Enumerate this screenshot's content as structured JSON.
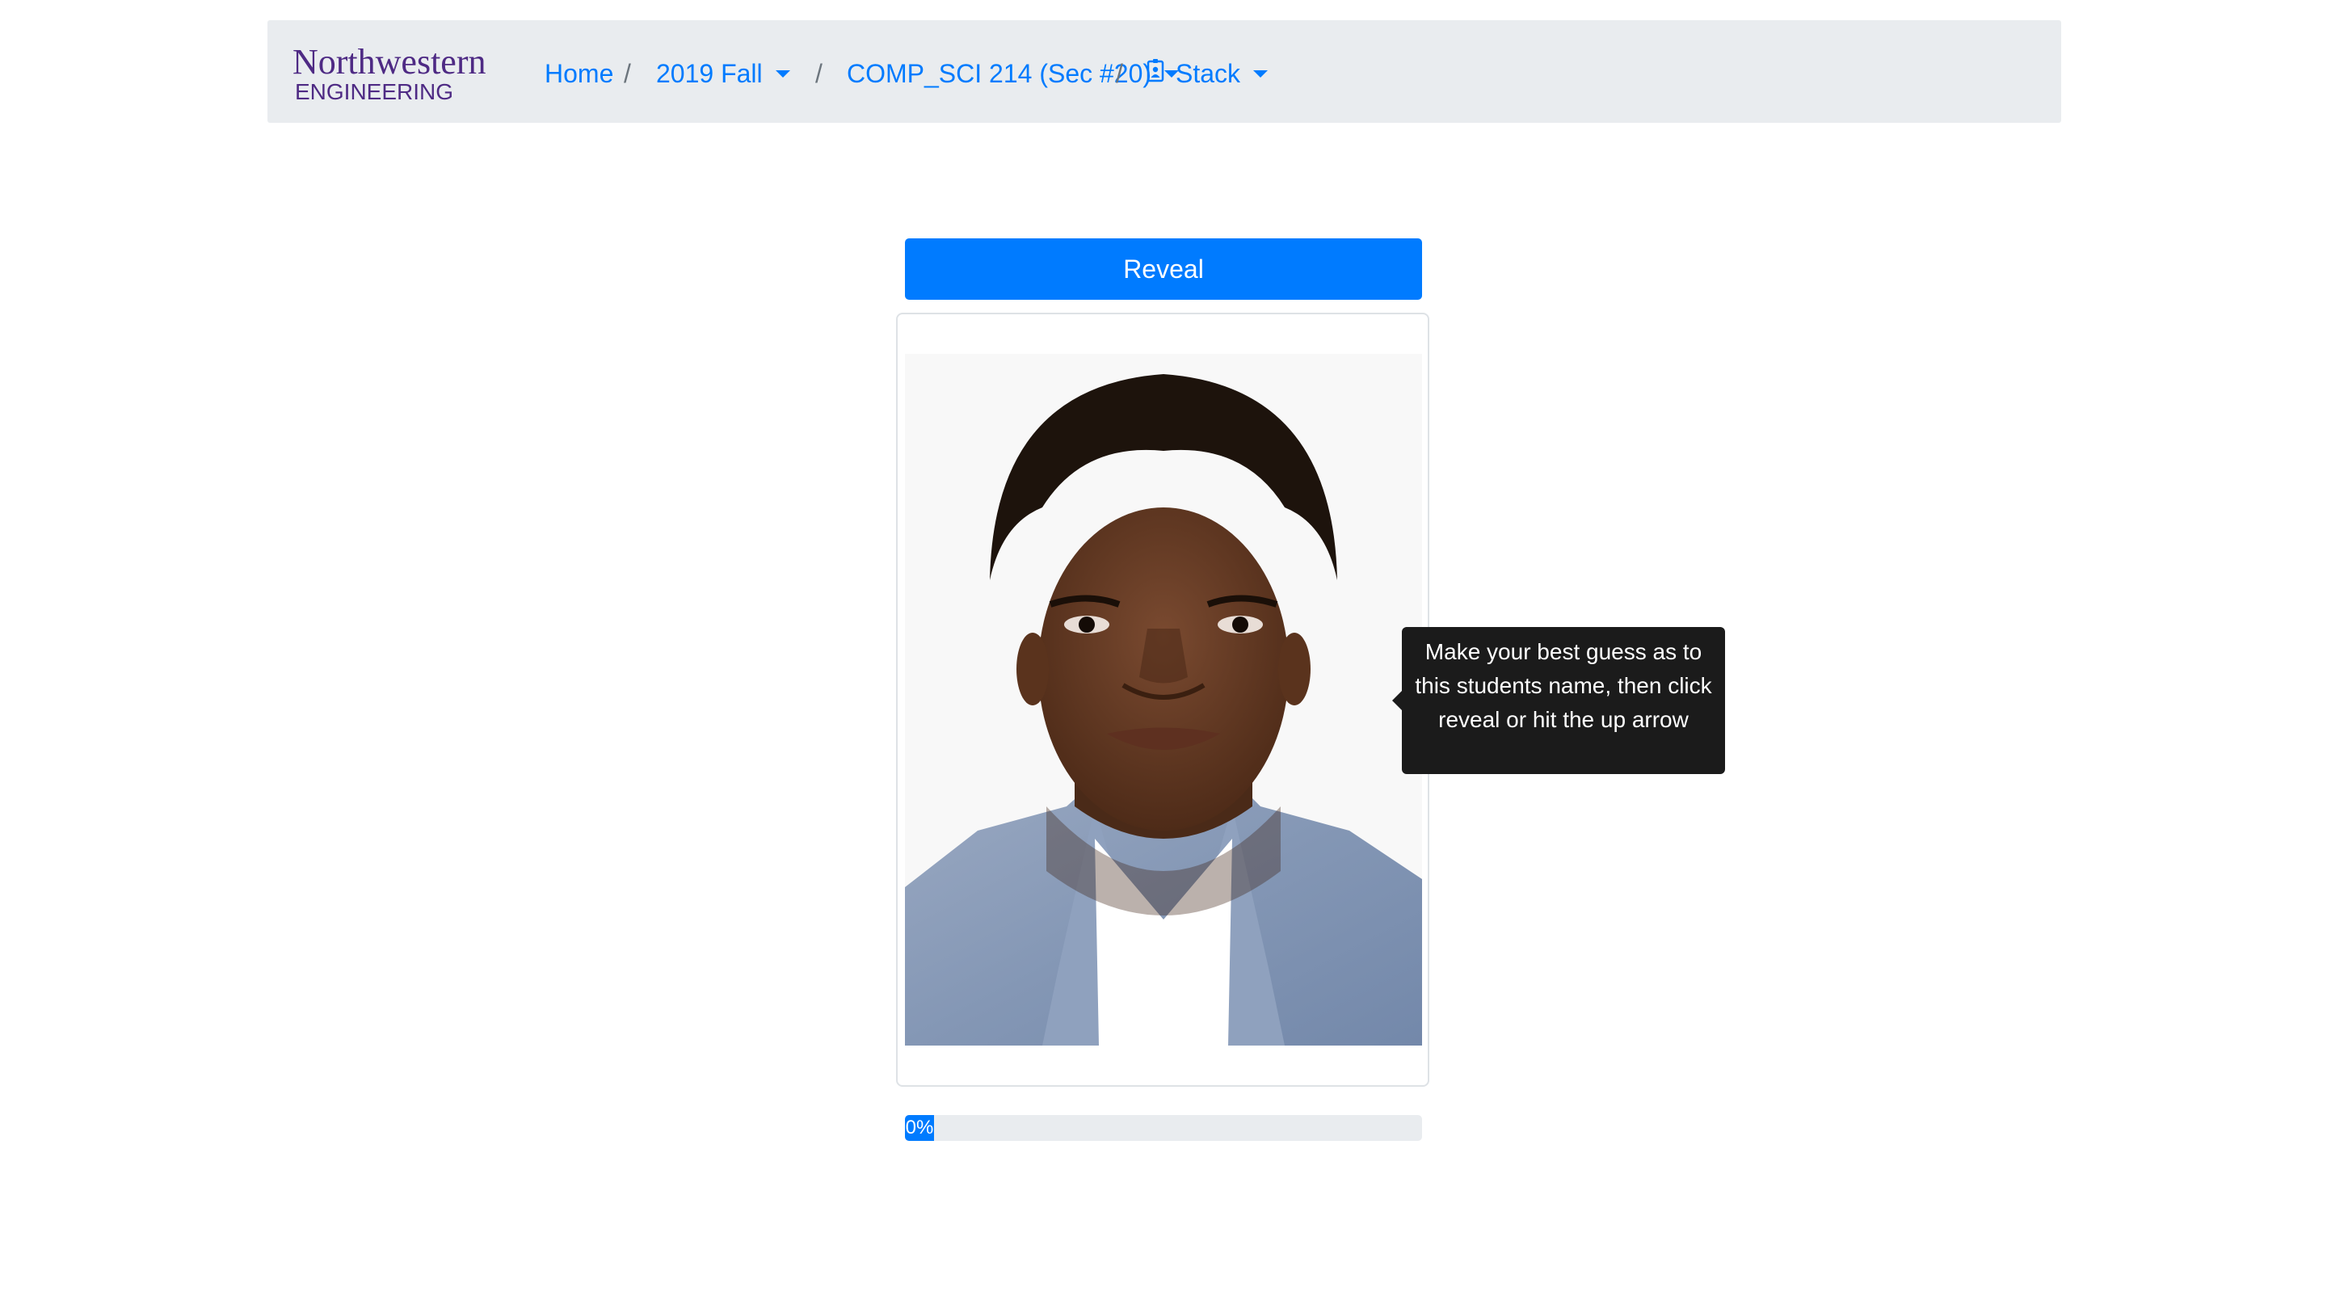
{
  "nav": {
    "logo_line1": "Northwestern",
    "logo_line2": "ENGINEERING",
    "breadcrumbs": [
      {
        "label": "Home"
      },
      {
        "label": "2019 Fall"
      },
      {
        "label": "COMP_SCI 214 (Sec #20)"
      },
      {
        "label": "Stack"
      }
    ],
    "separator": "/",
    "icons": {
      "dropdown": "caret-down-icon",
      "stack": "id-badge-icon"
    }
  },
  "reveal_button": {
    "label": "Reveal"
  },
  "tooltip": {
    "text": "Make your best guess as to this students name, then click reveal or hit the up arrow"
  },
  "progress": {
    "value": 0,
    "label": "0%"
  },
  "colors": {
    "primary": "#007bff",
    "brand_purple": "#4e2a84",
    "navbar_bg": "#e9ecef",
    "tooltip_bg": "#1b1b1b"
  }
}
